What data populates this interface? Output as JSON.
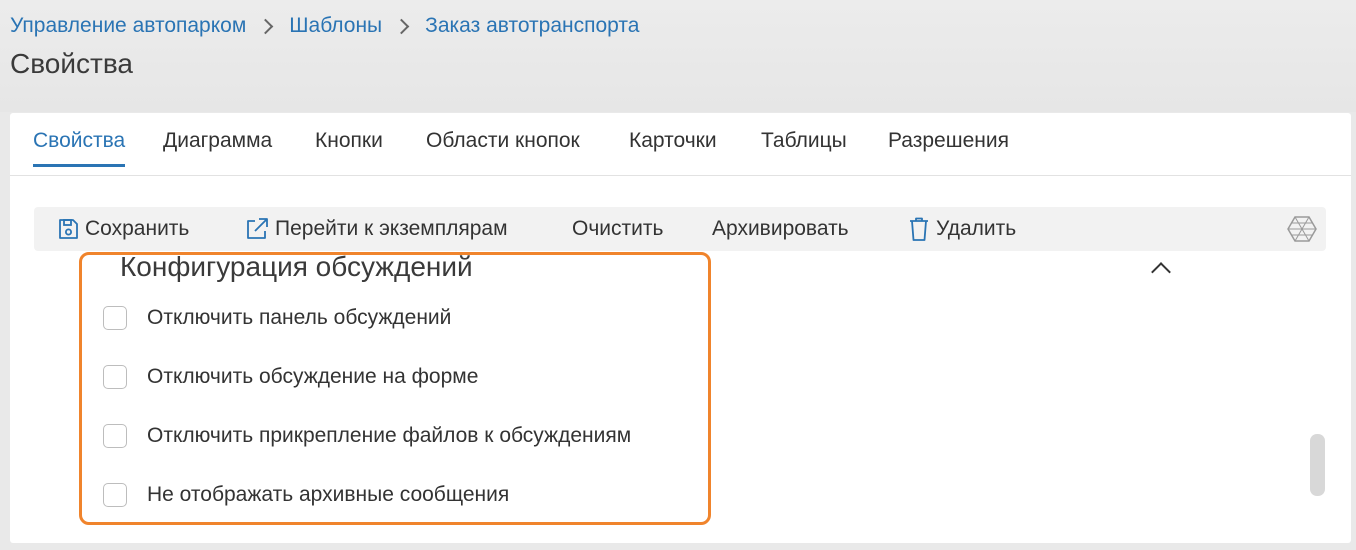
{
  "breadcrumb": {
    "items": [
      "Управление автопарком",
      "Шаблоны",
      "Заказ автотранспорта"
    ]
  },
  "page_title": "Свойства",
  "tabs": [
    {
      "label": "Свойства",
      "active": true
    },
    {
      "label": "Диаграмма",
      "active": false
    },
    {
      "label": "Кнопки",
      "active": false
    },
    {
      "label": "Области кнопок",
      "active": false
    },
    {
      "label": "Карточки",
      "active": false
    },
    {
      "label": "Таблицы",
      "active": false
    },
    {
      "label": "Разрешения",
      "active": false
    }
  ],
  "toolbar": {
    "save_label": "Сохранить",
    "save_icon": "save-icon",
    "goto_instances_label": "Перейти к экземплярам",
    "goto_icon": "external-link-icon",
    "clear_label": "Очистить",
    "archive_label": "Архивировать",
    "delete_label": "Удалить",
    "delete_icon": "trash-icon",
    "extra_icon": "hexagon-menu-icon"
  },
  "section": {
    "title": "Конфигурация обсуждений",
    "collapse_icon": "chevron-up-icon",
    "options": [
      {
        "label": "Отключить панель обсуждений",
        "checked": false
      },
      {
        "label": "Отключить обсуждение на форме",
        "checked": false
      },
      {
        "label": "Отключить прикрепление файлов к обсуждениям",
        "checked": false
      },
      {
        "label": "Не отображать архивные сообщения",
        "checked": false
      }
    ]
  },
  "colors": {
    "accent": "#2a74b4",
    "highlight": "#f0842c"
  }
}
